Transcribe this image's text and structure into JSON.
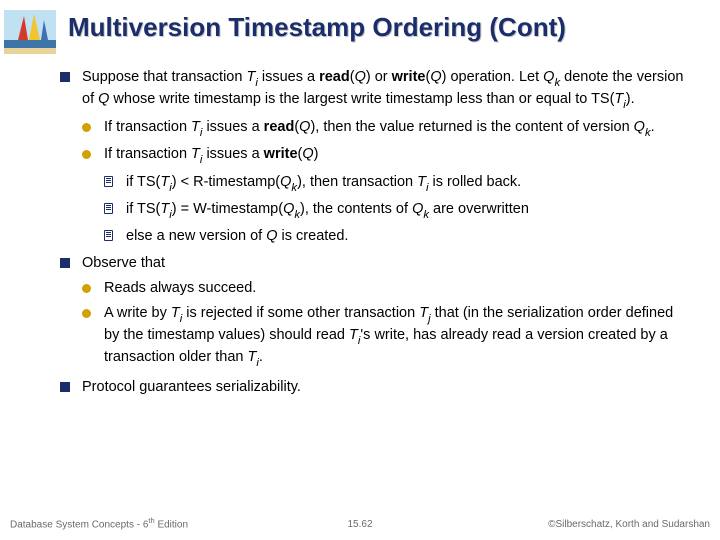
{
  "title": "Multiversion Timestamp Ordering (Cont)",
  "b1_a": "Suppose that transaction ",
  "b1_b": " issues a ",
  "b1_read": "read",
  "b1_c": "(",
  "b1_q1": "Q",
  "b1_d": ") or ",
  "b1_write": "write",
  "b1_e": "(",
  "b1_q2": "Q",
  "b1_f": ") operation.  Let ",
  "b1_g": " denote the version of ",
  "b1_q3": "Q",
  "b1_h": " whose write timestamp is the largest write timestamp less than or equal to TS(",
  "b1_i": ").",
  "b1s1_a": "If transaction ",
  "b1s1_b": " issues a ",
  "b1s1_read": "read",
  "b1s1_c": "(",
  "b1s1_q": "Q",
  "b1s1_d": "), then the value returned is the content of version ",
  "b1s1_e": ".",
  "b1s2_a": "If transaction ",
  "b1s2_b": " issues a  ",
  "b1s2_write": "write",
  "b1s2_c": "(",
  "b1s2_q": "Q",
  "b1s2_d": ")",
  "b1s2x1_a": "if TS(",
  "b1s2x1_b": ") < R-timestamp(",
  "b1s2x1_c": "), then transaction ",
  "b1s2x1_d": " is rolled back.",
  "b1s2x2_a": "if TS(",
  "b1s2x2_b": ") = W-timestamp(",
  "b1s2x2_c": "), the contents of ",
  "b1s2x2_d": " are overwritten",
  "b1s2x3": "else a new version of ",
  "b1s2x3_q": "Q",
  "b1s2x3_b": " is created.",
  "b2": "Observe that",
  "b2s1": "Reads always succeed.",
  "b2s2_a": "A write by ",
  "b2s2_b": " is rejected if some other transaction ",
  "b2s2_c": " that (in the serialization order defined by the timestamp values) should read ",
  "b2s2_d": "'s write, has already read a version created by a transaction older than ",
  "b2s2_e": ".",
  "b3": "Protocol guarantees serializability.",
  "T": "T",
  "Q": "Q",
  "sub_i": "i",
  "sub_j": "j",
  "sub_k": "k",
  "footer_left_a": "Database System Concepts - 6",
  "footer_left_sup": "th",
  "footer_left_b": " Edition",
  "footer_center": "15.62",
  "footer_right": "©Silberschatz, Korth and Sudarshan"
}
